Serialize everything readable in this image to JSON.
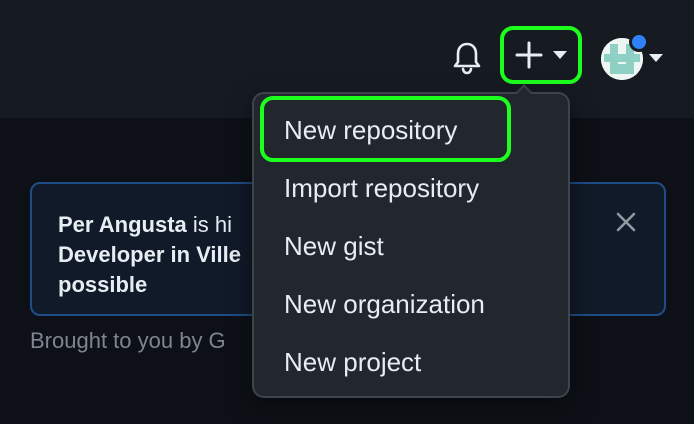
{
  "header": {
    "notifications_icon": "bell-icon",
    "create_icon": "plus-icon",
    "create_caret_icon": "caret-down-icon",
    "avatar_icon": "avatar",
    "avatar_caret_icon": "caret-down-icon"
  },
  "banner": {
    "name": "Per Angusta",
    "text_mid": " is hi",
    "line2": "Developer in Ville",
    "line3": "possible",
    "close_icon": "x-icon"
  },
  "footer_note": "Brought to you by G",
  "create_menu": {
    "items": [
      {
        "label": "New repository",
        "highlighted": true
      },
      {
        "label": "Import repository"
      },
      {
        "label": "New gist"
      },
      {
        "label": "New organization"
      },
      {
        "label": "New project"
      }
    ]
  },
  "colors": {
    "highlight": "#1dff1d",
    "header_bg": "#161b22",
    "page_bg": "#0d1117",
    "menu_bg": "#22272e",
    "banner_border": "#1f4d87",
    "notification_dot": "#2f81f7"
  }
}
